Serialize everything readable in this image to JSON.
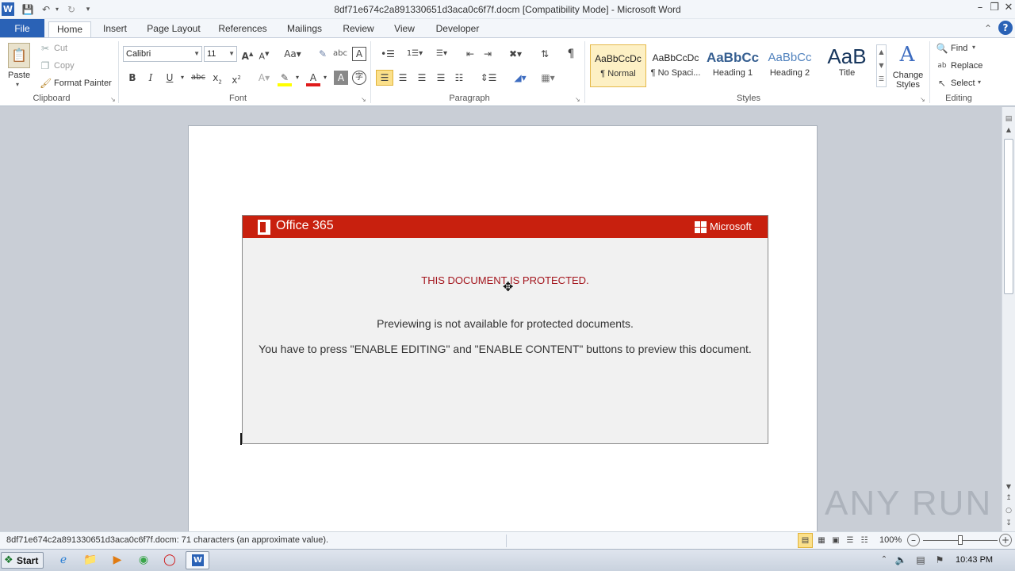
{
  "window": {
    "title": "8df71e674c2a891330651d3aca0c6f7f.docm [Compatibility Mode]  -  Microsoft Word"
  },
  "tabs": [
    "File",
    "Home",
    "Insert",
    "Page Layout",
    "References",
    "Mailings",
    "Review",
    "View",
    "Developer"
  ],
  "clipboard": {
    "paste": "Paste",
    "cut": "Cut",
    "copy": "Copy",
    "format_painter": "Format Painter",
    "group": "Clipboard"
  },
  "font": {
    "name": "Calibri",
    "size": "11",
    "group": "Font"
  },
  "paragraph": {
    "group": "Paragraph"
  },
  "styles": {
    "group": "Styles",
    "items": [
      {
        "sample": "AaBbCcDc",
        "name": "¶ Normal"
      },
      {
        "sample": "AaBbCcDc",
        "name": "¶ No Spaci..."
      },
      {
        "sample": "AaBbCc",
        "name": "Heading 1"
      },
      {
        "sample": "AaBbCc",
        "name": "Heading 2"
      },
      {
        "sample": "AaB",
        "name": "Title"
      }
    ],
    "change_styles": [
      "Change",
      "Styles"
    ]
  },
  "editing": {
    "group": "Editing",
    "find": "Find",
    "replace": "Replace",
    "select": "Select"
  },
  "document": {
    "brand_left": "Office 365",
    "brand_right": "Microsoft",
    "headline": "THIS DOCUMENT IS PROTECTED.",
    "line1": "Previewing is not available for protected documents.",
    "line2": "You have to press \"ENABLE EDITING\" and \"ENABLE CONTENT\" buttons to preview this document."
  },
  "status": {
    "text": "8df71e674c2a891330651d3aca0c6f7f.docm: 71 characters (an approximate value).",
    "zoom": "100%"
  },
  "taskbar": {
    "start": "Start",
    "clock": "10:43 PM"
  },
  "watermark": "ANY RUN",
  "colors": {
    "accent": "#2a62b6",
    "banner": "#c8200e",
    "headline": "#a3141c"
  }
}
